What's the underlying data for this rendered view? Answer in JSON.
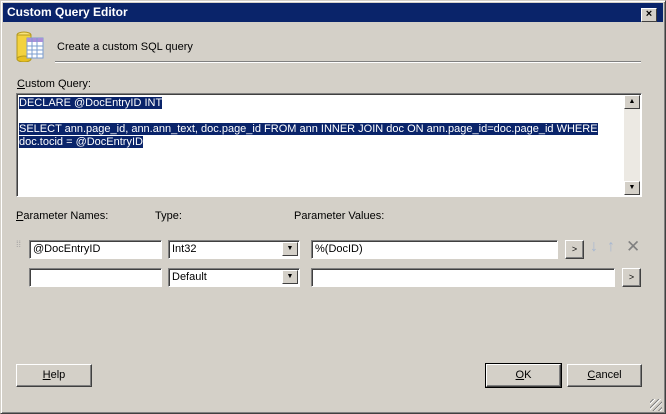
{
  "window": {
    "title": "Custom Query Editor",
    "close_label": "×"
  },
  "header": {
    "subtitle": "Create a custom SQL query"
  },
  "query": {
    "label": "Custom Query:",
    "line1": "DECLARE @DocEntryID INT",
    "line3": "SELECT ann.page_id, ann.ann_text, doc.page_id FROM ann INNER JOIN doc ON ann.page_id=doc.page_id WHERE",
    "line4": "doc.tocid = @DocEntryID"
  },
  "params": {
    "names_label": "Parameter Names:",
    "type_label": "Type:",
    "values_label": "Parameter Values:",
    "rows": [
      {
        "name": "@DocEntryID",
        "type": "Int32",
        "value": "%(DocID)",
        "browse": ">"
      },
      {
        "name": "",
        "type": "Default",
        "value": "",
        "browse": ">"
      }
    ]
  },
  "buttons": {
    "help": "Help",
    "ok": "OK",
    "cancel": "Cancel"
  }
}
